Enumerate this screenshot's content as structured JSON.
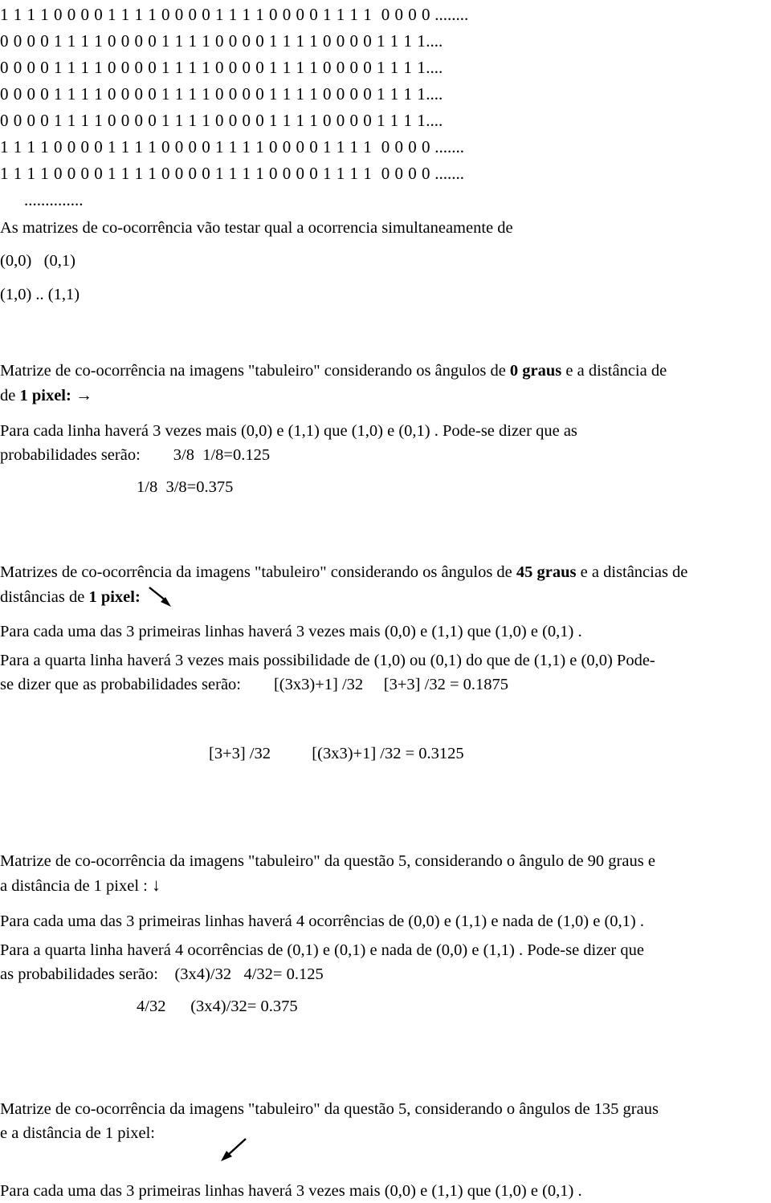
{
  "document": {
    "language": "pt-BR",
    "binary_rows": [
      {
        "bits": "1 1 1 1 0 0 0 0 1 1 1 1 0 0 0 0 1 1 1 1 0 0 0 0 1 1 1 1  0 0 0 0",
        "trailing": " ........"
      },
      {
        "bits": "0 0 0 0 1 1 1 1 0 0 0 0 1 1 1 1 0 0 0 0 1 1 1 1 0 0 0 0 1 1 1 1",
        "trailing": "...."
      },
      {
        "bits": "0 0 0 0 1 1 1 1 0 0 0 0 1 1 1 1 0 0 0 0 1 1 1 1 0 0 0 0 1 1 1 1",
        "trailing": "...."
      },
      {
        "bits": "0 0 0 0 1 1 1 1 0 0 0 0 1 1 1 1 0 0 0 0 1 1 1 1 0 0 0 0 1 1 1 1",
        "trailing": "...."
      },
      {
        "bits": "0 0 0 0 1 1 1 1 0 0 0 0 1 1 1 1 0 0 0 0 1 1 1 1 0 0 0 0 1 1 1 1",
        "trailing": "...."
      },
      {
        "bits": "1 1 1 1 0 0 0 0 1 1 1 1 0 0 0 0 1 1 1 1 0 0 0 0 1 1 1 1  0 0 0 0",
        "trailing": " ......."
      },
      {
        "bits": "1 1 1 1 0 0 0 0 1 1 1 1 0 0 0 0 1 1 1 1 0 0 0 0 1 1 1 1  0 0 0 0",
        "trailing": " ......."
      }
    ],
    "ellipsis_row": "..............",
    "intro_text": "As matrizes de co-ocorrência vão testar qual a ocorrencia simultaneamente de",
    "pair_row_1": "(0,0)   (0,1)",
    "pair_row_2": "(1,0) .. (1,1)",
    "section_0deg": {
      "heading_part1": "Matrize de co-ocorrência na imagens \"tabuleiro\"  considerando os ângulos de ",
      "heading_angle": "0 graus",
      "heading_part2": " e a distância de ",
      "heading_distance": "1 pixel:",
      "arrow_glyph": "→",
      "arrow_name": "arrow-right-icon",
      "body_line1": "Para cada linha haverá 3 vezes mais (0,0) e (1,1) que (1,0) e (0,1) . Pode-se dizer que as",
      "body_line2_label": "probabilidades serão:",
      "prob_row_1": "3/8  1/8=0.125",
      "prob_row_2": "1/8  3/8=0.375"
    },
    "section_45deg": {
      "heading_part1": "Matrizes de co-ocorrência da imagens \"tabuleiro\" considerando os ângulos de ",
      "heading_angle": "45 graus",
      "heading_part2": " e a distâncias de ",
      "heading_distance": "1 pixel:",
      "arrow_name": "arrow-down-right-icon",
      "body_line1": "Para cada uma das 3 primeiras linhas haverá 3 vezes mais (0,0) e (1,1) que (1,0) e (0,1) .",
      "body_line2": "Para a quarta linha haverá 3 vezes mais possibilidade de (1,0) ou (0,1) do que de (1,1) e (0,0) Pode-",
      "body_line3_label": "se dizer que as probabilidades serão:",
      "prob_row_1": "[(3x3)+1] /32     [3+3] /32 = 0.1875",
      "prob_row_2": "[3+3] /32          [(3x3)+1] /32 = 0.3125"
    },
    "section_90deg": {
      "heading_part1": "Matrize de co-ocorrência da imagens \"tabuleiro\" da questão 5, considerando o ângulo de 90 graus e",
      "heading_part2": "a distância de 1 pixel : ",
      "arrow_glyph": "↓",
      "arrow_name": "arrow-down-icon",
      "body_line1": "Para cada uma das 3 primeiras linhas haverá 4 ocorrências de (0,0) e (1,1) e nada de (1,0) e (0,1) .",
      "body_line2": "Para a quarta linha haverá 4 ocorrências de (0,1) e (0,1) e nada de (0,0) e (1,1) . Pode-se dizer que",
      "body_line3_label": "as probabilidades serão:",
      "prob_row_1": "(3x4)/32   4/32= 0.125",
      "prob_row_2": "4/32      (3x4)/32= 0.375"
    },
    "section_135deg": {
      "heading_part1": "Matrize de co-ocorrência da imagens \"tabuleiro\" da questão 5, considerando o ângulos de 135 graus",
      "heading_part2": "e a distância de 1 pixel:",
      "arrow_name": "arrow-down-left-icon",
      "body_line1": "Para cada uma das 3 primeiras linhas haverá 3 vezes mais (0,0) e (1,1) que (1,0) e (0,1) ."
    }
  }
}
